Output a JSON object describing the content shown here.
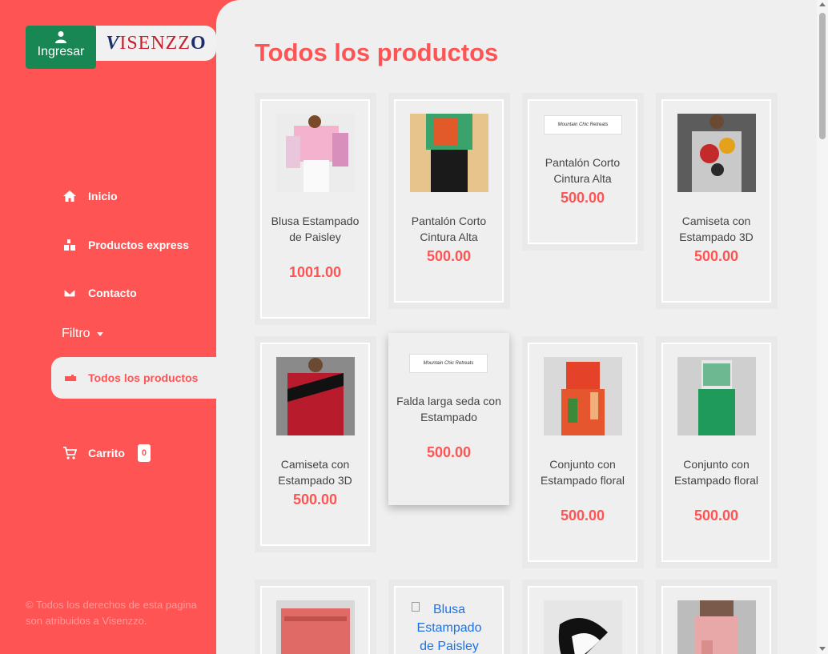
{
  "header": {
    "login_label": "Ingresar",
    "logo_text": "VISENZZO",
    "logo_text_parts": [
      "V",
      "ISENZZ",
      "O"
    ]
  },
  "sidebar": {
    "items": [
      {
        "label": "Inicio",
        "icon": "home-icon"
      },
      {
        "label": "Productos express",
        "icon": "box-icon"
      },
      {
        "label": "Contacto",
        "icon": "envelope-icon"
      }
    ],
    "filter_label": "Filtro",
    "active_label": "Todos los productos",
    "cart_label": "Carrito",
    "cart_count": "0",
    "footer": "© Todos los derechos de esta pagina son atribuidos a Visenzzo."
  },
  "main": {
    "title": "Todos los productos",
    "products": [
      {
        "name": "Blusa Estampado de Paisley",
        "price": "1001.00",
        "image": "pink-paisley-blouse"
      },
      {
        "name": "Pantalón Corto Cintura Alta",
        "price": "500.00",
        "image": "tropical-top-black-pants"
      },
      {
        "name": "Pantalón Corto Cintura Alta",
        "price": "500.00",
        "image": "banner",
        "banner_text": "Mountain Chic Retreats"
      },
      {
        "name": "Camiseta con Estampado 3D",
        "price": "500.00",
        "image": "3d-print-shirt"
      },
      {
        "name": "Camiseta con Estampado 3D",
        "price": "500.00",
        "image": "red-black-tee"
      },
      {
        "name": "Falda larga seda con Estampado",
        "price": "500.00",
        "image": "banner",
        "banner_text": "Mountain Chic Retreats"
      },
      {
        "name": "Conjunto con Estampado floral",
        "price": "500.00",
        "image": "red-floral-set"
      },
      {
        "name": "Conjunto con Estampado floral",
        "price": "500.00",
        "image": "green-wide-pants"
      },
      {
        "name": "",
        "price": "",
        "image": "coral-offshoulder-top"
      },
      {
        "name": "",
        "price": "",
        "image": "broken",
        "alt": "Blusa Estampado de Paisley"
      },
      {
        "name": "",
        "price": "",
        "image": "black-white-swirl-dress"
      },
      {
        "name": "",
        "price": "",
        "image": "pink-cargo-pants"
      }
    ]
  },
  "colors": {
    "brand": "#ff5454",
    "login": "#198754",
    "panel": "#efefef"
  }
}
